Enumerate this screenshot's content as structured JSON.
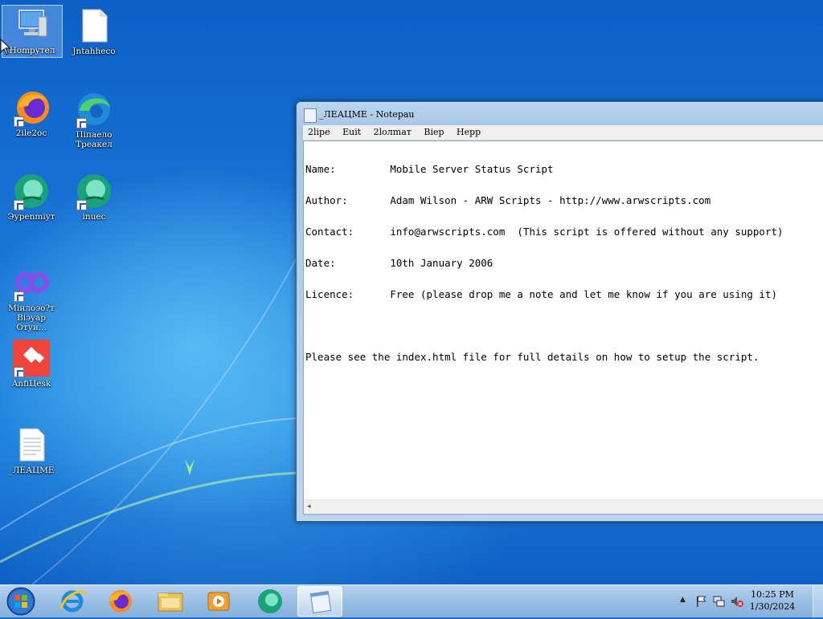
{
  "desktop": {
    "icons": [
      {
        "label": "Нompyтeл",
        "icon": "computer-icon"
      },
      {
        "label": "Jntahheco",
        "icon": "document-icon"
      },
      {
        "label": "2ilе2oc",
        "icon": "firefox-icon"
      },
      {
        "label": "Пiпaeло Треaкел",
        "icon": "edge-icon"
      },
      {
        "label": "Эуреnmiyт",
        "icon": "app-icon"
      },
      {
        "label": "inuec",
        "icon": "app-icon"
      },
      {
        "label": "Мiнлоэо?т Віэyар Отуи...",
        "icon": "visual-studio-icon"
      },
      {
        "label": "AnfiЦеsk",
        "icon": "anydesk-icon"
      },
      {
        "label": "_ЛЕАЦМЕ",
        "icon": "text-file-icon"
      }
    ]
  },
  "notepad": {
    "title": "_ЛЕАЦМЕ - Notepau",
    "menu": [
      "2lipe",
      "Euit",
      "2lолmат",
      "Віер",
      "Неpр"
    ],
    "lines": [
      "Name:         Mobile Server Status Script",
      "Author:       Adam Wilson - ARW Scripts - http://www.arwscripts.com",
      "Contact:      info@arwscripts.com  (This script is offered without any support)",
      "Date:         10th January 2006",
      "Licence:      Free (please drop me a note and let me know if you are using it)",
      "",
      "Please see the index.html file for full details on how to setup the script."
    ]
  },
  "taskbar": {
    "pinned": [
      "internet-explorer-icon",
      "firefox-icon",
      "file-explorer-icon",
      "media-player-icon",
      "app-icon",
      "notepad-icon"
    ],
    "clock": {
      "time": "10:25 PM",
      "date": "1/30/2024"
    }
  }
}
